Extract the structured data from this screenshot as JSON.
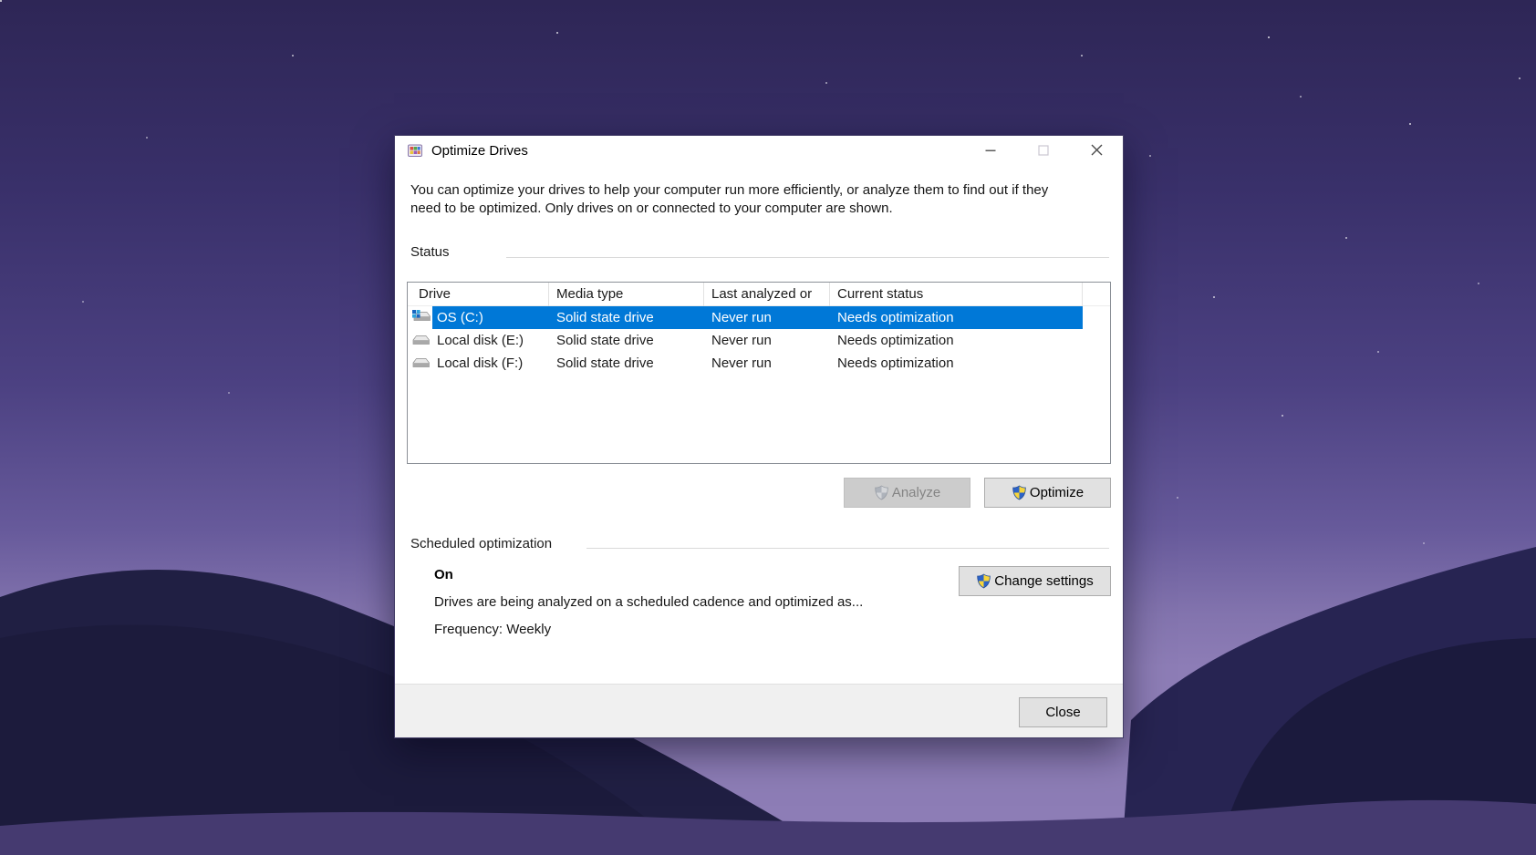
{
  "window": {
    "title": "Optimize Drives",
    "icons": {
      "app": "defrag-app-icon",
      "minimize": "─",
      "maximize": "▢",
      "close": "✕",
      "os_drive": "drive-with-windows-logo",
      "local_drive": "gray-disk-drive",
      "uac_shield": "blue-yellow-security-shield"
    },
    "description": "You can optimize your drives to help your computer run more efficiently, or analyze them to find out if they need to be optimized. Only drives on or connected to your computer are shown.",
    "status_section": {
      "label": "Status",
      "table": {
        "columns": [
          "Drive",
          "Media type",
          "Last analyzed or …",
          "Current status"
        ],
        "rows": [
          {
            "drive": "OS (C:)",
            "media_type": "Solid state drive",
            "last_analyzed": "Never run",
            "current_status": "Needs optimization",
            "selected": true
          },
          {
            "drive": "Local disk (E:)",
            "media_type": "Solid state drive",
            "last_analyzed": "Never run",
            "current_status": "Needs optimization",
            "selected": false
          },
          {
            "drive": "Local disk (F:)",
            "media_type": "Solid state drive",
            "last_analyzed": "Never run",
            "current_status": "Needs optimization",
            "selected": false
          }
        ]
      },
      "analyze_button": "Analyze",
      "optimize_button": "Optimize"
    },
    "scheduled_section": {
      "label": "Scheduled optimization",
      "state": "On",
      "description": "Drives are being analyzed on a scheduled cadence and optimized as...",
      "frequency": "Frequency: Weekly",
      "change_settings_button": "Change settings"
    },
    "footer": {
      "close_button": "Close"
    },
    "colors": {
      "selection_blue": "#0078d7",
      "window_bg": "#ffffff",
      "footer_bg": "#f0f0f0",
      "disabled_button_bg": "#cccccc",
      "button_bg": "#e1e1e1"
    }
  }
}
